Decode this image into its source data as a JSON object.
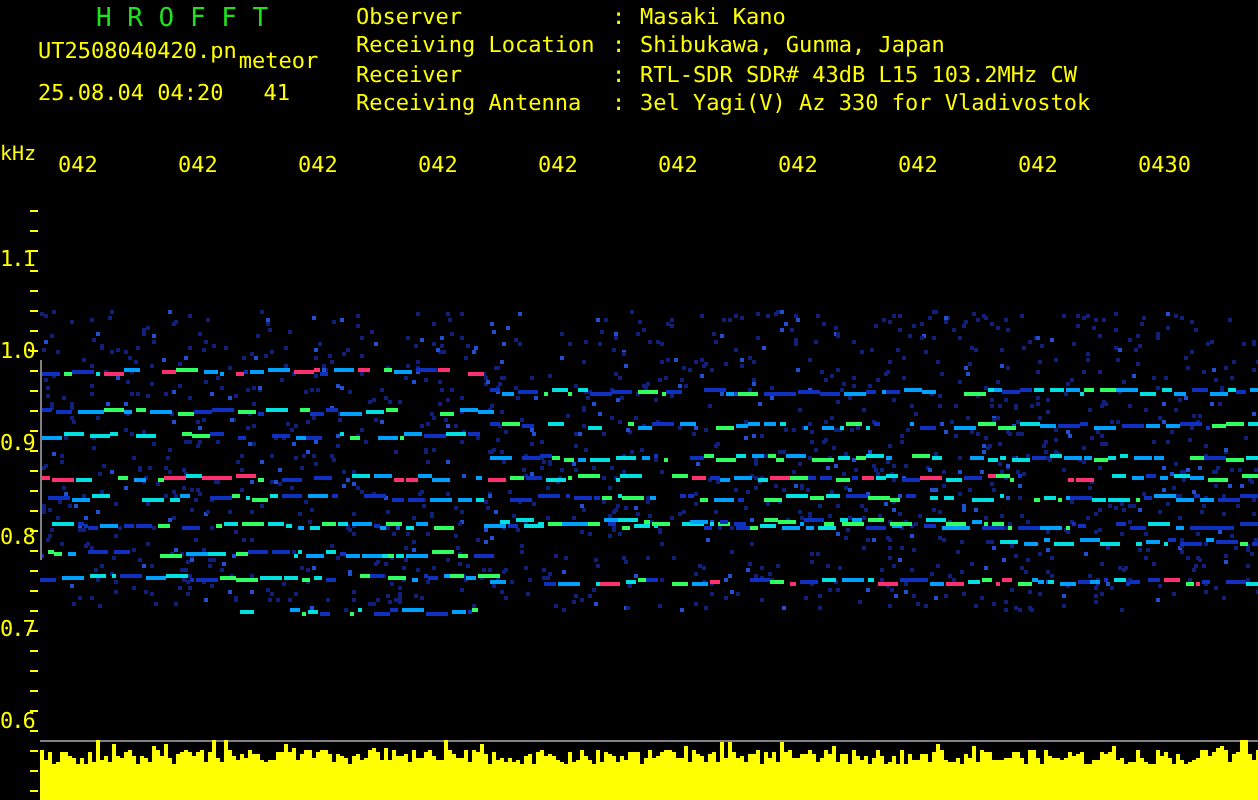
{
  "title": "H R O F F T",
  "file": {
    "name": "UT2508040420.pn",
    "type": "meteor",
    "timestamp": "25.08.04 04:20",
    "count": "41"
  },
  "info": [
    {
      "label": "Observer",
      "value": "Masaki Kano"
    },
    {
      "label": "Receiving Location",
      "value": "Shibukawa, Gunma, Japan"
    },
    {
      "label": "Receiver",
      "value": "RTL-SDR SDR# 43dB L15 103.2MHz CW"
    },
    {
      "label": "Receiving Antenna",
      "value": "3el Yagi(V) Az 330 for Vladivostok"
    }
  ],
  "separator": ":",
  "axis_unit": "kHz",
  "time_labels": [
    "042",
    "042",
    "042",
    "042",
    "042",
    "042",
    "042",
    "042",
    "042",
    "0430"
  ],
  "frequency_labels": [
    "1.1",
    "1.0",
    "0.9",
    "0.8",
    "0.7",
    "0.6"
  ]
}
